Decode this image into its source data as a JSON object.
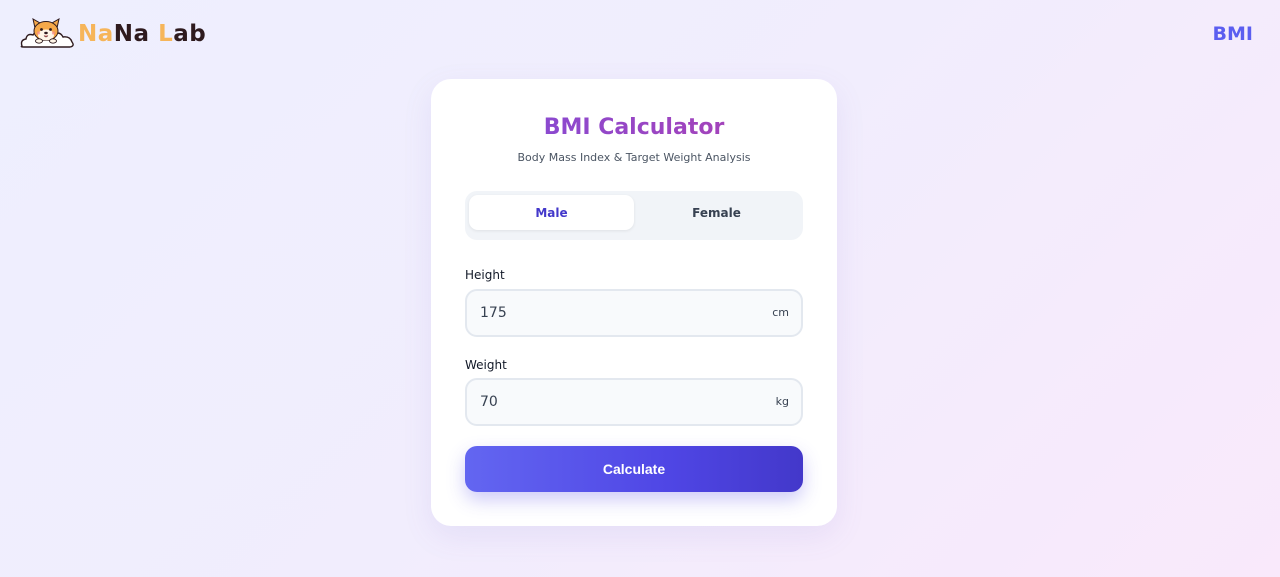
{
  "header": {
    "logo_parts": [
      {
        "text": "Na",
        "color": "#f6b55a"
      },
      {
        "text": "Na",
        "color": "#2e1a1e"
      },
      {
        "text": " ",
        "color": "#2e1a1e"
      },
      {
        "text": "L",
        "color": "#f6b55a"
      },
      {
        "text": "ab",
        "color": "#2e1a1e"
      }
    ],
    "logo_icon": "shiba-dog-cloud-icon",
    "nav_link": "BMI",
    "nav_color": "#5b5ef0"
  },
  "card": {
    "title": "BMI Calculator",
    "subtitle": "Body Mass Index & Target Weight Analysis",
    "gender_toggle": {
      "options": [
        "Male",
        "Female"
      ],
      "selected": "Male"
    },
    "height": {
      "label": "Height",
      "value": "175",
      "unit": "cm"
    },
    "weight": {
      "label": "Weight",
      "value": "70",
      "unit": "kg"
    },
    "calculate_label": "Calculate"
  },
  "colors": {
    "accent": "#4f46e5",
    "title_gradient_start": "#7c4ddc",
    "title_gradient_end": "#b23fae"
  }
}
